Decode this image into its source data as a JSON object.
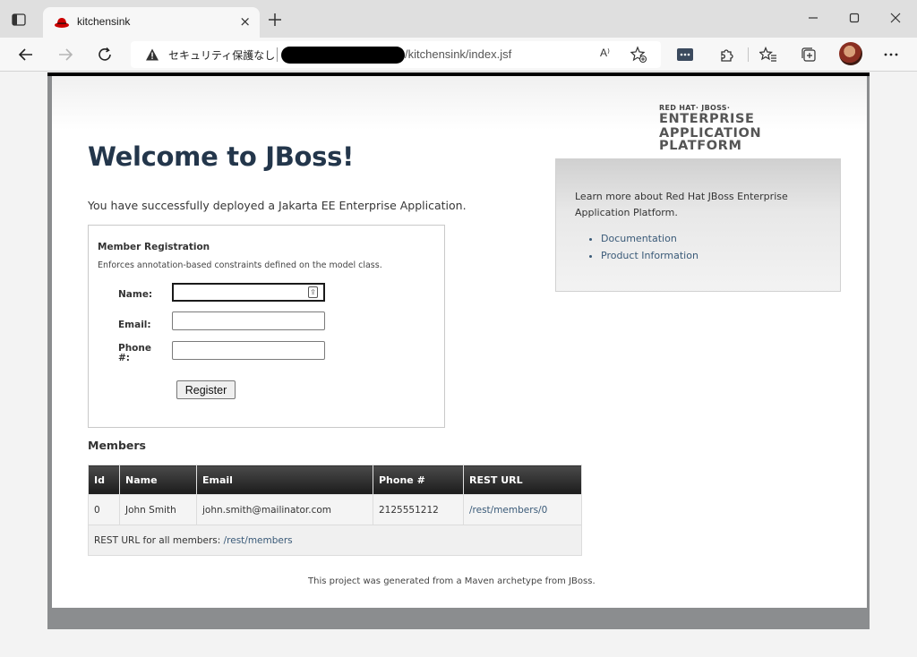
{
  "browser": {
    "tab_title": "kitchensink",
    "tab_close": "×",
    "address": {
      "security_label": "セキュリティ保護なし",
      "url_suffix": "/kitchensink/index.jsf",
      "read_aloud_label": "A⁾"
    }
  },
  "page": {
    "logo": {
      "line1": "RED HAT· JBOSS·",
      "line2": "ENTERPRISE",
      "line3": "APPLICATION PLATFORM"
    },
    "title": "Welcome to JBoss!",
    "intro": "You have successfully deployed a Jakarta EE Enterprise Application.",
    "registration": {
      "title": "Member Registration",
      "description": "Enforces annotation-based constraints defined on the model class.",
      "name_label": "Name:",
      "email_label": "Email:",
      "phone_label_1": "Phone",
      "phone_label_2": "#:",
      "name_value": "",
      "email_value": "",
      "phone_value": "",
      "register_button": "Register"
    },
    "info": {
      "text": "Learn more about Red Hat JBoss Enterprise Application Platform.",
      "links": [
        "Documentation",
        "Product Information"
      ]
    },
    "members": {
      "title": "Members",
      "columns": [
        "Id",
        "Name",
        "Email",
        "Phone #",
        "REST URL"
      ],
      "rows": [
        [
          "0",
          "John Smith",
          "john.smith@mailinator.com",
          "2125551212",
          "/rest/members/0"
        ]
      ],
      "footer_label": "REST URL for all members:",
      "footer_link": "/rest/members"
    },
    "footer": "This project was generated from a Maven archetype from JBoss."
  },
  "colors": {
    "title": "#23364b",
    "link": "#3a5a78",
    "table_header": "#1b1b1b",
    "favicon": "#cc0000"
  },
  "icons": [
    "tab-actions-icon",
    "redhat-favicon-icon",
    "close-icon",
    "plus-icon",
    "minimize-icon",
    "maximize-icon",
    "window-close-icon",
    "back-icon",
    "forward-icon",
    "refresh-icon",
    "warning-icon",
    "add-favorite-icon",
    "extension-badge-icon",
    "extensions-icon",
    "favorites-icon",
    "collections-icon",
    "more-icon",
    "autofill-icon"
  ]
}
